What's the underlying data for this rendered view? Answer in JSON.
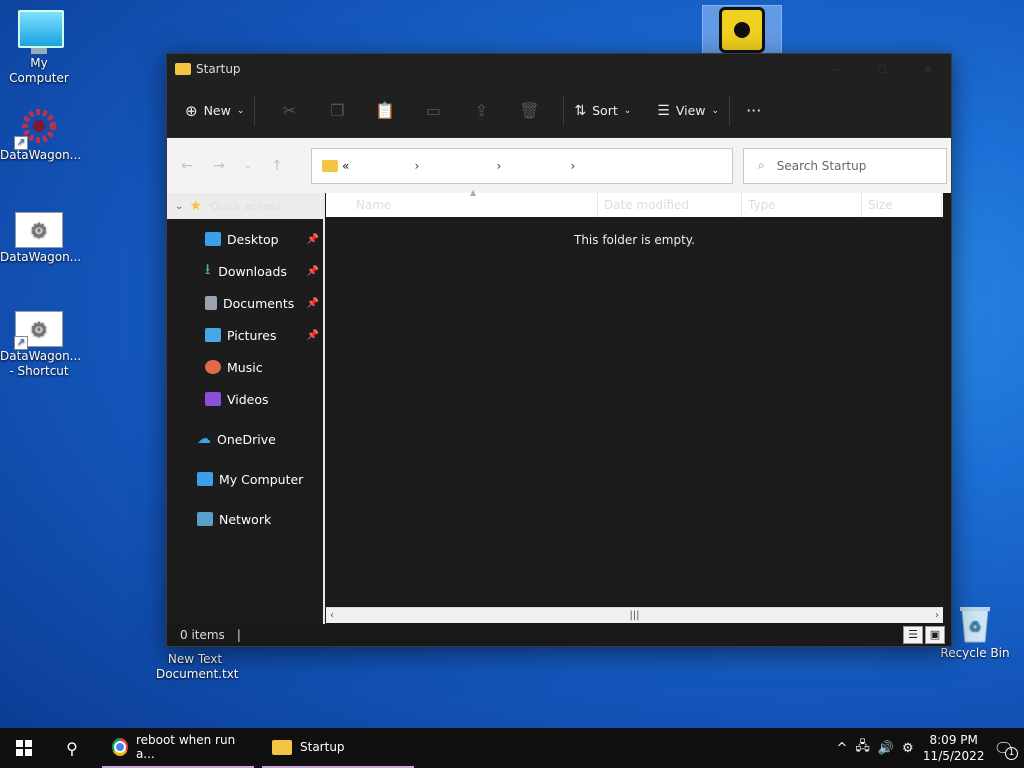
{
  "desktop": {
    "icons": [
      {
        "label": "My Computer"
      },
      {
        "label": "DataWagon..."
      },
      {
        "label": "DataWagon..."
      },
      {
        "label": "DataWagon...\n- Shortcut"
      },
      {
        "label": "New Text\nDocument.txt"
      },
      {
        "label": "Recycle Bin"
      }
    ]
  },
  "window": {
    "title": "Startup",
    "toolbar": {
      "new_label": "New",
      "sort_label": "Sort",
      "view_label": "View",
      "more_label": "···"
    },
    "address": {
      "prefix": "«",
      "crumbs": [
        "",
        "",
        ""
      ]
    },
    "search": {
      "placeholder": "Search Startup"
    },
    "nav": {
      "quick_access": "Quick access",
      "items": [
        {
          "label": "Desktop",
          "pinned": true,
          "color": "#3aa0e8"
        },
        {
          "label": "Downloads",
          "pinned": true,
          "color": "#3cc47a"
        },
        {
          "label": "Documents",
          "pinned": true,
          "color": "#9aa3ad"
        },
        {
          "label": "Pictures",
          "pinned": true,
          "color": "#48a6e8"
        },
        {
          "label": "Music",
          "pinned": false,
          "color": "#e06a4a"
        },
        {
          "label": "Videos",
          "pinned": false,
          "color": "#8a4fd8"
        }
      ],
      "onedrive": "OneDrive",
      "mycomputer": "My Computer",
      "network": "Network"
    },
    "columns": [
      "Name",
      "Date modified",
      "Type",
      "Size"
    ],
    "empty_message": "This folder is empty.",
    "status": "0 items"
  },
  "taskbar": {
    "apps": [
      {
        "label": "reboot when run a..."
      },
      {
        "label": "Startup"
      }
    ],
    "time": "8:09 PM",
    "date": "11/5/2022",
    "notification_count": "1"
  },
  "colors": {
    "accent": "#0b5cd6",
    "folder": "#f4c542"
  }
}
